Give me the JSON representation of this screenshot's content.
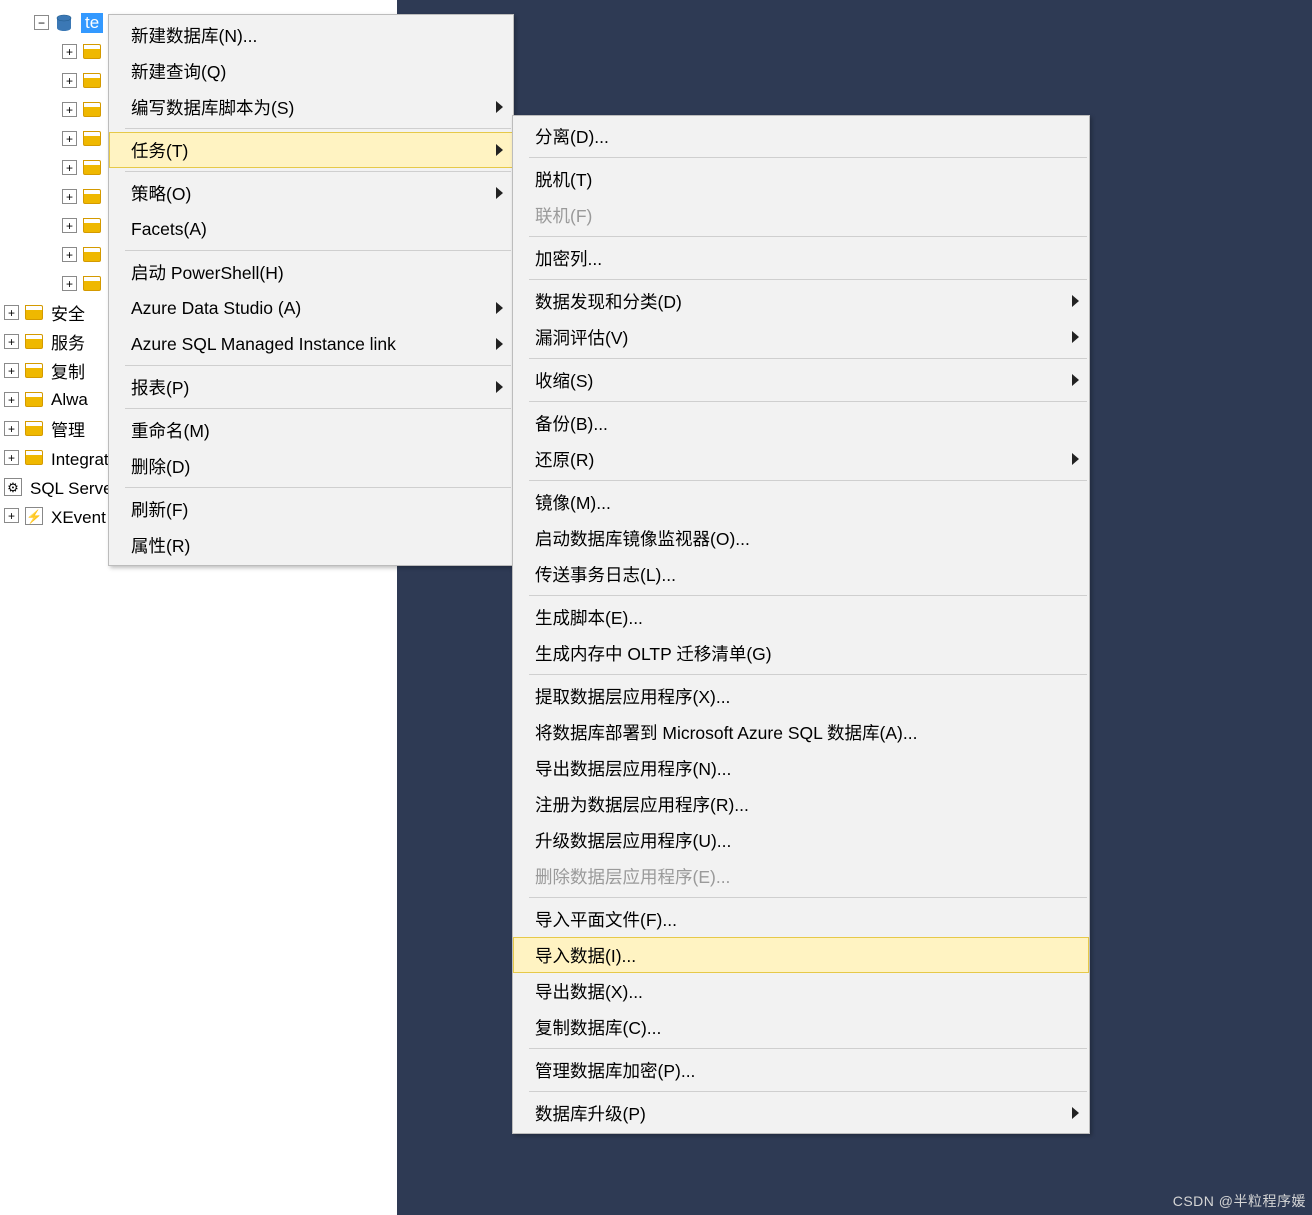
{
  "tree": {
    "selected_db": "te",
    "db_children": [
      {
        "label": ""
      },
      {
        "label": ""
      },
      {
        "label": ""
      },
      {
        "label": ""
      },
      {
        "label": ""
      },
      {
        "label": ""
      },
      {
        "label": ""
      },
      {
        "label": ""
      },
      {
        "label": ""
      }
    ],
    "nodes": [
      {
        "label": "安全"
      },
      {
        "label": "服务"
      },
      {
        "label": "复制"
      },
      {
        "label": "Alwa"
      },
      {
        "label": "管理"
      },
      {
        "label": "Integration Services 目录"
      },
      {
        "label": "SQL Server 代理(已禁用代理 XP)"
      },
      {
        "label": "XEvent 探查器"
      }
    ]
  },
  "menu1": [
    {
      "label": "新建数据库(N)..."
    },
    {
      "label": "新建查询(Q)"
    },
    {
      "label": "编写数据库脚本为(S)",
      "arrow": true,
      "sepAfter": true
    },
    {
      "label": "任务(T)",
      "arrow": true,
      "highlight": true,
      "sepAfter": true
    },
    {
      "label": "策略(O)",
      "arrow": true
    },
    {
      "label": "Facets(A)",
      "sepAfter": true
    },
    {
      "label": "启动 PowerShell(H)"
    },
    {
      "label": "Azure Data Studio (A)",
      "arrow": true
    },
    {
      "label": "Azure SQL Managed Instance link",
      "arrow": true,
      "sepAfter": true
    },
    {
      "label": "报表(P)",
      "arrow": true,
      "sepAfter": true
    },
    {
      "label": "重命名(M)"
    },
    {
      "label": "删除(D)",
      "sepAfter": true
    },
    {
      "label": "刷新(F)"
    },
    {
      "label": "属性(R)"
    }
  ],
  "menu2": [
    {
      "label": "分离(D)...",
      "sepAfter": true
    },
    {
      "label": "脱机(T)"
    },
    {
      "label": "联机(F)",
      "disabled": true,
      "sepAfter": true
    },
    {
      "label": "加密列...",
      "sepAfter": true
    },
    {
      "label": "数据发现和分类(D)",
      "arrow": true
    },
    {
      "label": "漏洞评估(V)",
      "arrow": true,
      "sepAfter": true
    },
    {
      "label": "收缩(S)",
      "arrow": true,
      "sepAfter": true
    },
    {
      "label": "备份(B)..."
    },
    {
      "label": "还原(R)",
      "arrow": true,
      "sepAfter": true
    },
    {
      "label": "镜像(M)..."
    },
    {
      "label": "启动数据库镜像监视器(O)..."
    },
    {
      "label": "传送事务日志(L)...",
      "sepAfter": true
    },
    {
      "label": "生成脚本(E)..."
    },
    {
      "label": "生成内存中 OLTP 迁移清单(G)",
      "sepAfter": true
    },
    {
      "label": "提取数据层应用程序(X)..."
    },
    {
      "label": "将数据库部署到 Microsoft Azure SQL 数据库(A)..."
    },
    {
      "label": "导出数据层应用程序(N)..."
    },
    {
      "label": "注册为数据层应用程序(R)..."
    },
    {
      "label": "升级数据层应用程序(U)..."
    },
    {
      "label": "删除数据层应用程序(E)...",
      "disabled": true,
      "sepAfter": true
    },
    {
      "label": "导入平面文件(F)..."
    },
    {
      "label": "导入数据(I)...",
      "highlight": true
    },
    {
      "label": "导出数据(X)..."
    },
    {
      "label": "复制数据库(C)...",
      "sepAfter": true
    },
    {
      "label": "管理数据库加密(P)...",
      "sepAfter": true
    },
    {
      "label": "数据库升级(P)",
      "arrow": true
    }
  ],
  "watermark": "CSDN @半粒程序媛"
}
